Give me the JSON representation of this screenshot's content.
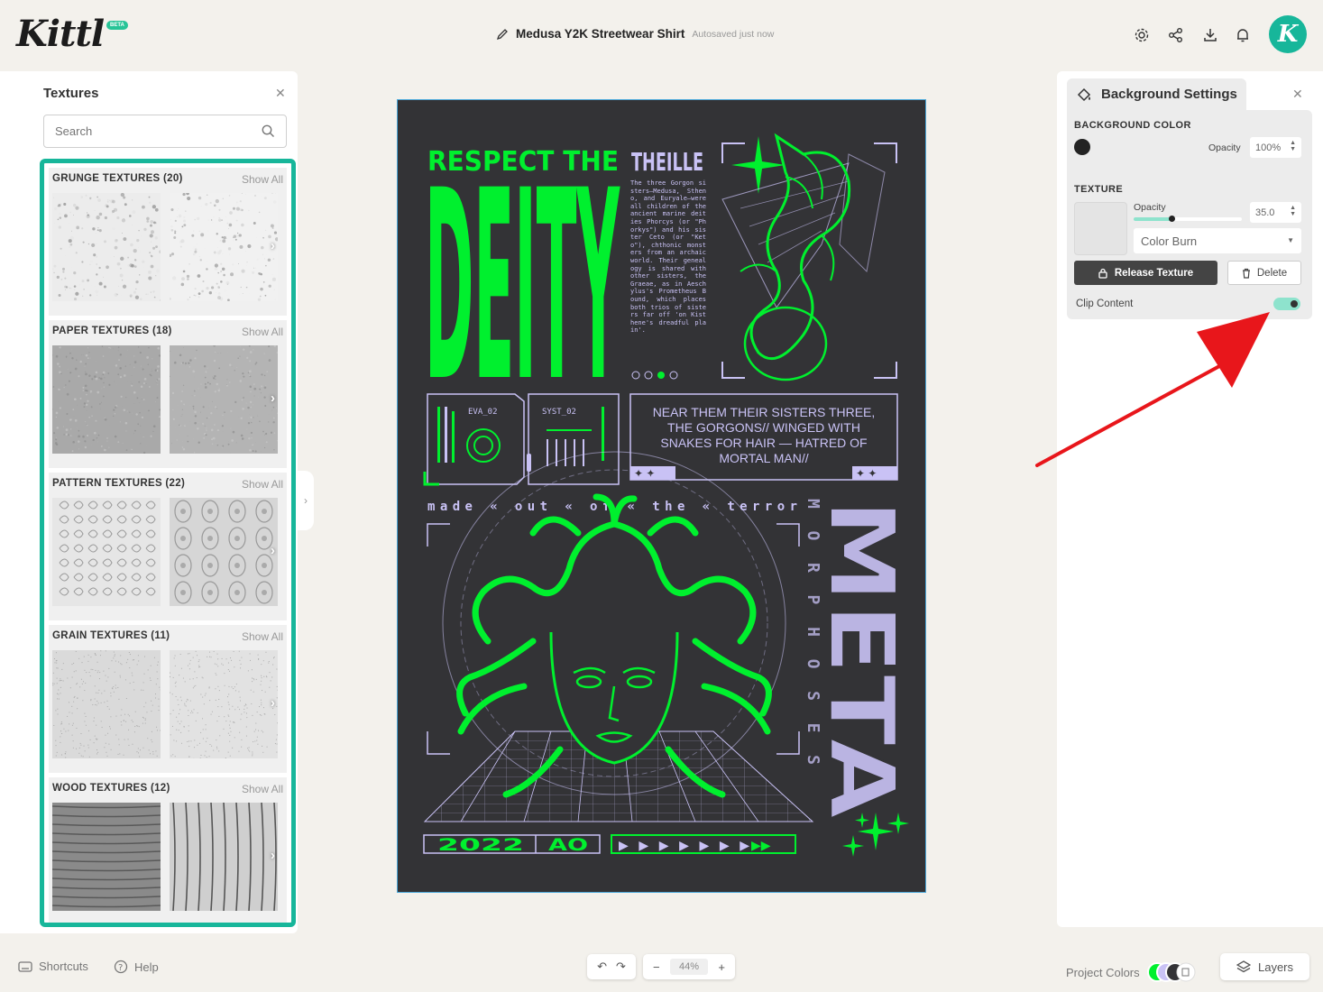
{
  "app": {
    "logo": "Kittl",
    "badge": "BETA"
  },
  "header": {
    "doc_title": "Medusa Y2K Streetwear Shirt",
    "autosave": "Autosaved just now",
    "avatar_letter": "K"
  },
  "textures_panel": {
    "title": "Textures",
    "search_placeholder": "Search",
    "show_all": "Show All",
    "sections": [
      {
        "title": "GRUNGE TEXTURES (20)"
      },
      {
        "title": "PAPER TEXTURES (18)"
      },
      {
        "title": "PATTERN TEXTURES (22)"
      },
      {
        "title": "GRAIN TEXTURES (11)"
      },
      {
        "title": "WOOD TEXTURES (12)"
      }
    ]
  },
  "poster": {
    "headline_small": "RESPECT THE",
    "headline_sub": "THEILLE",
    "headline_big": "DEITY",
    "body_text": "The three Gorgon sisters—Medusa, Stheno, and Euryale—were all children of the ancient marine deities Phorcys (or \"Phorkys\") and his sister Ceto (or \"Keto\"), chthonic monsters from an archaic world. Their genealogy is shared with other sisters, the Graeae, as in Aeschylus's Prometheus Bound, which places both trios of sisters far off 'on Kisthene's dreadful plain'.",
    "panel_a_label": "EVA_02",
    "panel_b_label": "SYST_02",
    "quote": "NEAR THEM THEIR SISTERS THREE, THE GORGONS// WINGED WITH SNAKES FOR HAIR — HATRED OF MORTAL MAN//",
    "tagline": "made « out « of « the « terror",
    "vertical_small": "MORPHOSES",
    "vertical_big": "META",
    "year": "2022",
    "code": "AO",
    "accent": "#00f02e",
    "lavender": "#c9c2f5",
    "background": "#333336"
  },
  "bg_panel": {
    "title": "Background Settings",
    "bg_color_label": "BACKGROUND COLOR",
    "bg_color": "#232323",
    "opacity_label": "Opacity",
    "bg_opacity": "100%",
    "texture_label": "TEXTURE",
    "texture_opacity_label": "Opacity",
    "texture_opacity": "35.0",
    "texture_opacity_fraction": 0.35,
    "blend_mode": "Color Burn",
    "release_label": "Release Texture",
    "delete_label": "Delete",
    "clip_label": "Clip Content",
    "clip_on": true
  },
  "footer": {
    "shortcuts": "Shortcuts",
    "help": "Help",
    "zoom": "44%",
    "project_colors": "Project Colors",
    "layers": "Layers"
  },
  "colors": {
    "brand": "#17b69a",
    "arrow": "#e8161b"
  }
}
